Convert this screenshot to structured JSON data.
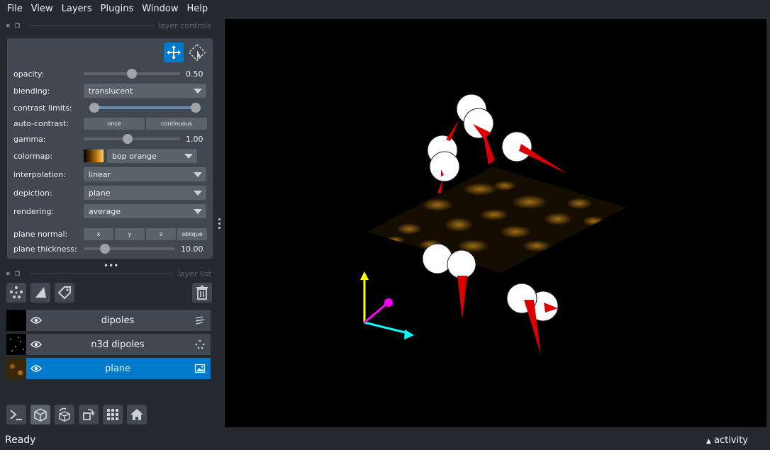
{
  "menu": [
    "File",
    "View",
    "Layers",
    "Plugins",
    "Window",
    "Help"
  ],
  "dock": {
    "controls_title": "layer controls",
    "list_title": "layer list"
  },
  "controls": {
    "opacity": {
      "label": "opacity:",
      "value": "0.50",
      "level": 0.5
    },
    "blending": {
      "label": "blending:",
      "value": "translucent"
    },
    "contrast": {
      "label": "contrast limits:",
      "low": 0.0,
      "high": 1.0
    },
    "auto_contrast": {
      "label": "auto-contrast:",
      "once": "once",
      "continuous": "continuous"
    },
    "gamma": {
      "label": "gamma:",
      "value": "1.00",
      "level": 0.45
    },
    "colormap": {
      "label": "colormap:",
      "value": "bop orange"
    },
    "interpolation": {
      "label": "interpolation:",
      "value": "linear"
    },
    "depiction": {
      "label": "depiction:",
      "value": "plane"
    },
    "rendering": {
      "label": "rendering:",
      "value": "average"
    },
    "plane_normal": {
      "label": "plane normal:",
      "buttons": [
        "x",
        "y",
        "z",
        "oblique"
      ]
    },
    "plane_thickness": {
      "label": "plane thickness:",
      "value": "10.00",
      "level": 0.2
    }
  },
  "layers": [
    {
      "name": "dipoles",
      "type_icon": "vectors-icon",
      "selected": false
    },
    {
      "name": "n3d dipoles",
      "type_icon": "points-icon",
      "selected": false
    },
    {
      "name": "plane",
      "type_icon": "image-icon",
      "selected": true
    }
  ],
  "status": {
    "text": "Ready",
    "activity": "activity"
  },
  "colors": {
    "accent": "#007acc",
    "panel": "#414851",
    "background": "#262930",
    "axis_x": "#00ffff",
    "axis_y": "#ffff00",
    "axis_z": "#ff00ff",
    "vectors": "#dd0000"
  }
}
